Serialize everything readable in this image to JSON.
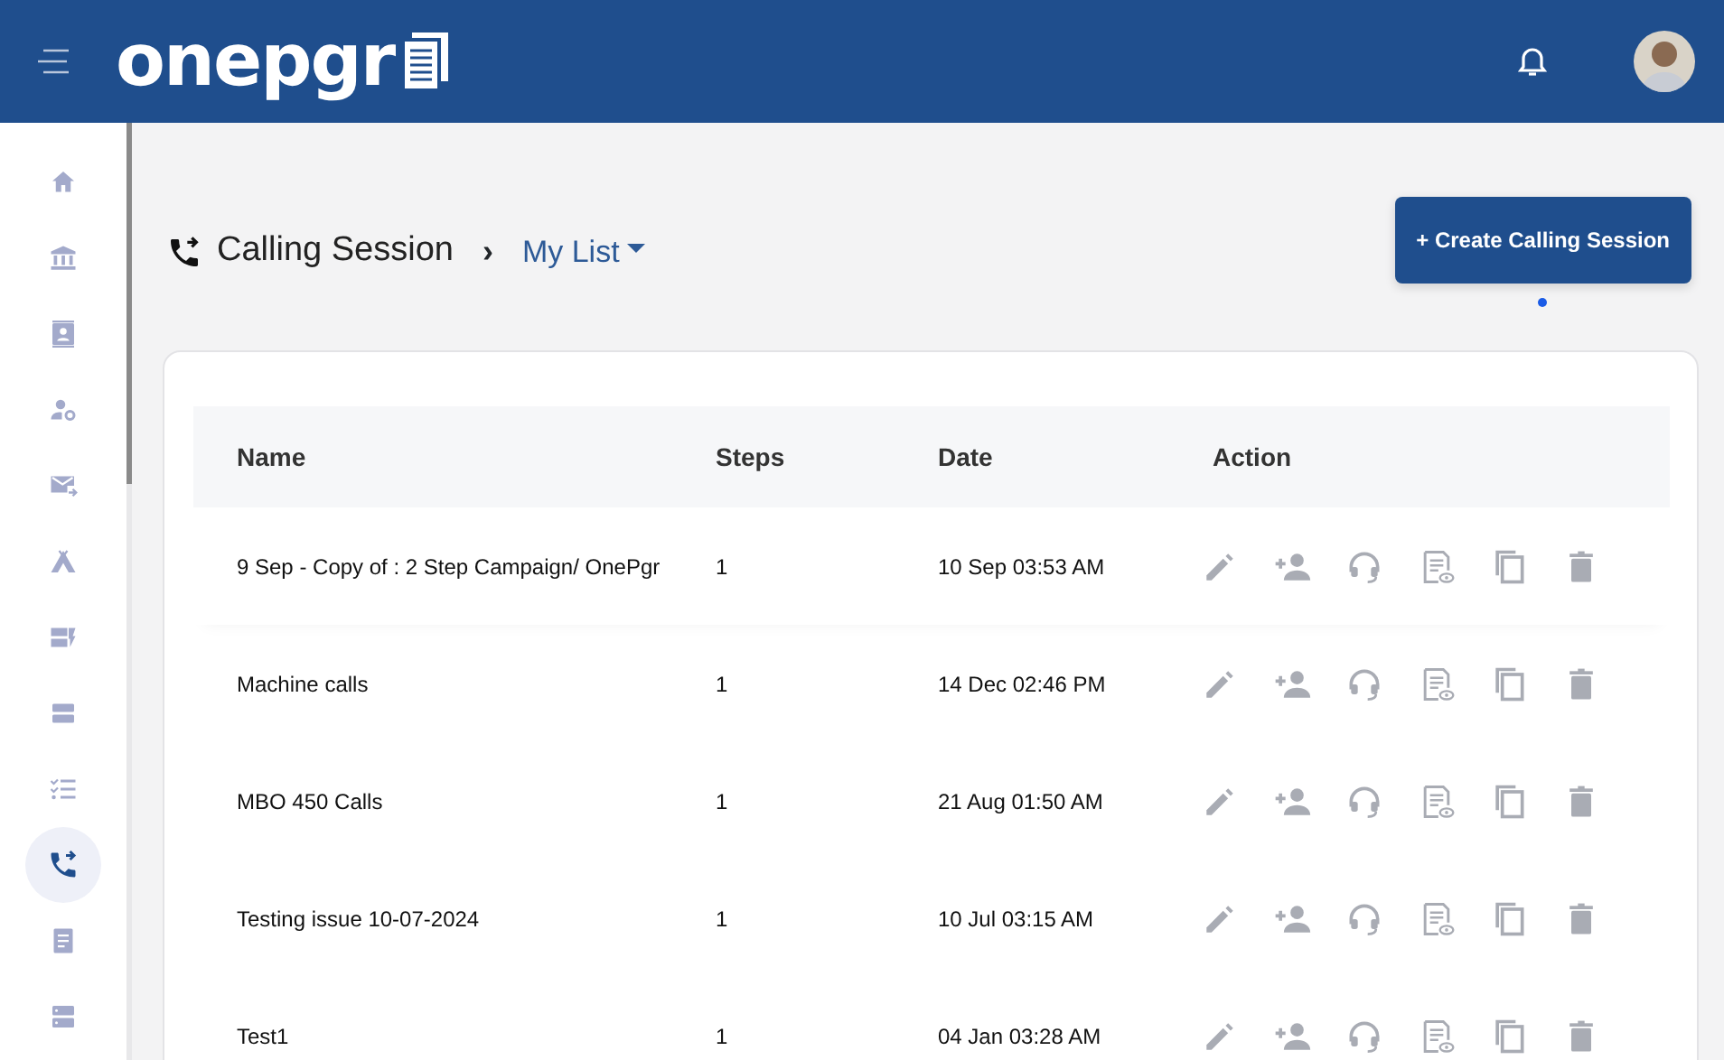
{
  "header": {
    "logo": "onepgr"
  },
  "sidebar": {
    "items": [
      {
        "selected": false
      },
      {
        "selected": false
      },
      {
        "selected": false
      },
      {
        "selected": false
      },
      {
        "selected": false
      },
      {
        "selected": false
      },
      {
        "selected": false
      },
      {
        "selected": false
      },
      {
        "selected": false
      },
      {
        "selected": true
      },
      {
        "selected": false
      },
      {
        "selected": false
      }
    ]
  },
  "page": {
    "title": "Calling Session",
    "breadcrumb_separator": "›",
    "list_menu": "My List",
    "create_button": "+ Create Calling Session"
  },
  "table": {
    "columns": [
      "Name",
      "Steps",
      "Date",
      "Action"
    ],
    "rows": [
      {
        "name": "9 Sep - Copy of : 2 Step Campaign/ OnePgr",
        "steps": "1",
        "date": "10 Sep 03:53 AM"
      },
      {
        "name": "Machine calls",
        "steps": "1",
        "date": "14 Dec 02:46 PM"
      },
      {
        "name": "MBO 450 Calls",
        "steps": "1",
        "date": "21 Aug 01:50 AM"
      },
      {
        "name": "Testing issue 10-07-2024",
        "steps": "1",
        "date": "10 Jul 03:15 AM"
      },
      {
        "name": "Test1",
        "steps": "1",
        "date": "04 Jan 03:28 AM"
      }
    ]
  }
}
